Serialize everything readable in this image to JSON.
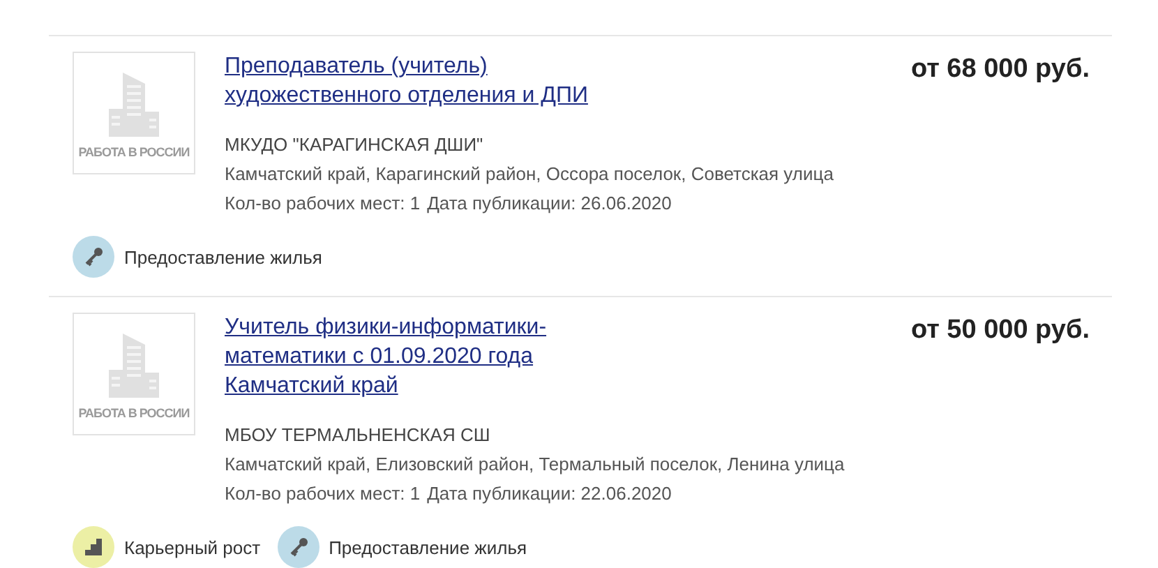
{
  "vacancies": [
    {
      "logo_text": "РАБОТА В РОССИИ",
      "title_lines": [
        "Преподаватель (учитель)",
        "художественного отделения и ДПИ"
      ],
      "salary": "от 68 000 руб.",
      "company": "МКУДО \"КАРАГИНСКАЯ ДШИ\"",
      "address": "Камчатский край, Карагинский район, Оссора поселок, Советская улица",
      "workplaces": "Кол-во рабочих мест: 1",
      "published": "Дата публикации: 26.06.2020",
      "perks": [
        {
          "kind": "housing",
          "label": "Предоставление жилья"
        }
      ]
    },
    {
      "logo_text": "РАБОТА В РОССИИ",
      "title_lines": [
        "Учитель физики-информатики-",
        "математики с 01.09.2020 года",
        "Камчатский край"
      ],
      "salary": "от 50 000 руб.",
      "company": "МБОУ ТЕРМАЛЬНЕНСКАЯ СШ",
      "address": "Камчатский край, Елизовский район, Термальный поселок, Ленина улица",
      "workplaces": "Кол-во рабочих мест: 1",
      "published": "Дата публикации: 22.06.2020",
      "perks": [
        {
          "kind": "career",
          "label": "Карьерный рост"
        },
        {
          "kind": "housing",
          "label": "Предоставление жилья"
        }
      ]
    }
  ]
}
